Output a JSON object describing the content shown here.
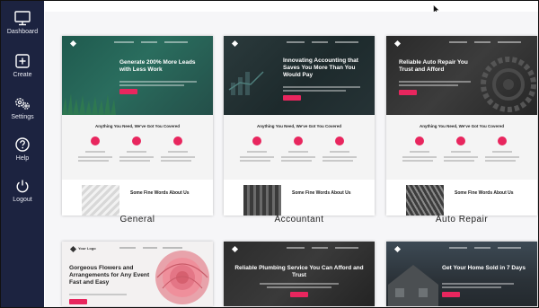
{
  "sidebar": {
    "items": [
      {
        "label": "Dashboard",
        "icon": "monitor-icon"
      },
      {
        "label": "Create",
        "icon": "plus-square-icon"
      },
      {
        "label": "Settings",
        "icon": "gears-icon"
      },
      {
        "label": "Help",
        "icon": "question-circle-icon"
      },
      {
        "label": "Logout",
        "icon": "power-icon"
      }
    ]
  },
  "templates": [
    {
      "name": "General",
      "headline": "Generate 200% More Leads with Less Work",
      "section_title": "Anything You Need, We've Got You Covered",
      "foot_title": "Some Fine Words About Us"
    },
    {
      "name": "Accountant",
      "headline": "Innovating Accounting that Saves You More Than You Would Pay",
      "section_title": "Anything You Need, We've Got You Covered",
      "foot_title": "Some Fine Words About Us"
    },
    {
      "name": "Auto Repair",
      "headline": "Reliable Auto Repair You Trust and Afford",
      "section_title": "Anything You Need, We've Got You Covered",
      "foot_title": "Some Fine Words About Us"
    },
    {
      "name": "",
      "logo_text": "Your Logo",
      "headline": "Gorgeous Flowers and Arrangements for Any Event Fast and Easy"
    },
    {
      "name": "",
      "headline": "Reliable Plumbing Service You Can Afford and Trust"
    },
    {
      "name": "",
      "headline": "Get Your Home Sold in 7 Days"
    }
  ],
  "colors": {
    "sidebar": "#1c2340",
    "accent": "#e8265e"
  }
}
